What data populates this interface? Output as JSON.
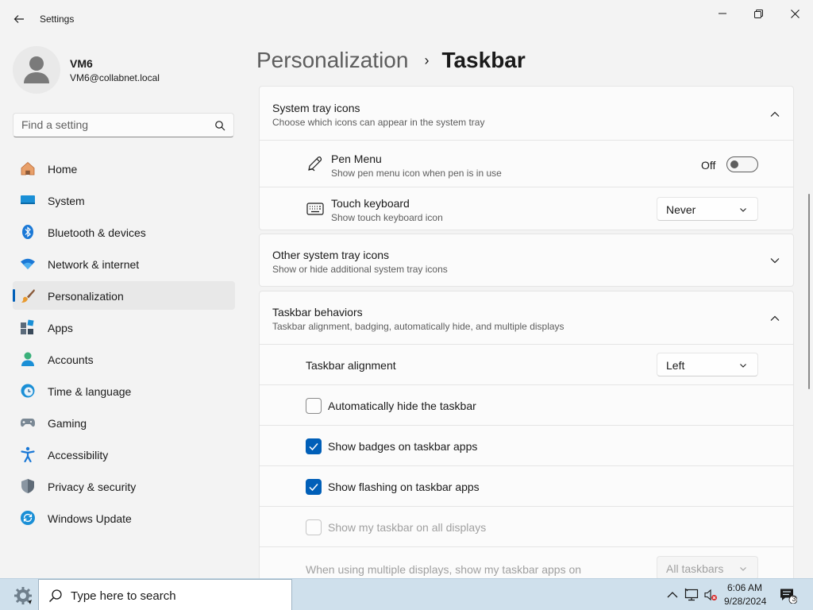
{
  "window": {
    "title": "Settings"
  },
  "user": {
    "name": "VM6",
    "email": "VM6@collabnet.local"
  },
  "search": {
    "placeholder": "Find a setting"
  },
  "nav": {
    "items": [
      {
        "label": "Home",
        "icon": "home-icon"
      },
      {
        "label": "System",
        "icon": "system-icon"
      },
      {
        "label": "Bluetooth & devices",
        "icon": "bluetooth-icon"
      },
      {
        "label": "Network & internet",
        "icon": "wifi-icon"
      },
      {
        "label": "Personalization",
        "icon": "brush-icon",
        "active": true
      },
      {
        "label": "Apps",
        "icon": "apps-icon"
      },
      {
        "label": "Accounts",
        "icon": "accounts-icon"
      },
      {
        "label": "Time & language",
        "icon": "clock-globe-icon"
      },
      {
        "label": "Gaming",
        "icon": "gamepad-icon"
      },
      {
        "label": "Accessibility",
        "icon": "accessibility-icon"
      },
      {
        "label": "Privacy & security",
        "icon": "shield-icon"
      },
      {
        "label": "Windows Update",
        "icon": "update-icon"
      }
    ]
  },
  "breadcrumb": {
    "parent": "Personalization",
    "separator": "›",
    "current": "Taskbar"
  },
  "sections": {
    "system_tray": {
      "title": "System tray icons",
      "subtitle": "Choose which icons can appear in the system tray",
      "pen_menu": {
        "title": "Pen Menu",
        "subtitle": "Show pen menu icon when pen is in use",
        "state_label": "Off",
        "on": false
      },
      "touch_keyboard": {
        "title": "Touch keyboard",
        "subtitle": "Show touch keyboard icon",
        "value": "Never"
      }
    },
    "other_tray": {
      "title": "Other system tray icons",
      "subtitle": "Show or hide additional system tray icons"
    },
    "behaviors": {
      "title": "Taskbar behaviors",
      "subtitle": "Taskbar alignment, badging, automatically hide, and multiple displays",
      "alignment": {
        "label": "Taskbar alignment",
        "value": "Left"
      },
      "auto_hide": {
        "label": "Automatically hide the taskbar",
        "checked": false
      },
      "badges": {
        "label": "Show badges on taskbar apps",
        "checked": true
      },
      "flashing": {
        "label": "Show flashing on taskbar apps",
        "checked": true
      },
      "all_displays": {
        "label": "Show my taskbar on all displays",
        "checked": false,
        "disabled": true
      },
      "multi_display": {
        "label": "When using multiple displays, show my taskbar apps on",
        "value": "All taskbars",
        "disabled": true
      }
    }
  },
  "taskbar": {
    "search_placeholder": "Type here to search",
    "time": "6:06 AM",
    "date": "9/28/2024",
    "notification_count": "3"
  },
  "colors": {
    "accent": "#005fb8",
    "background": "#f3f3f3",
    "card": "#fbfbfb",
    "taskbar": "#cfe0ec"
  }
}
